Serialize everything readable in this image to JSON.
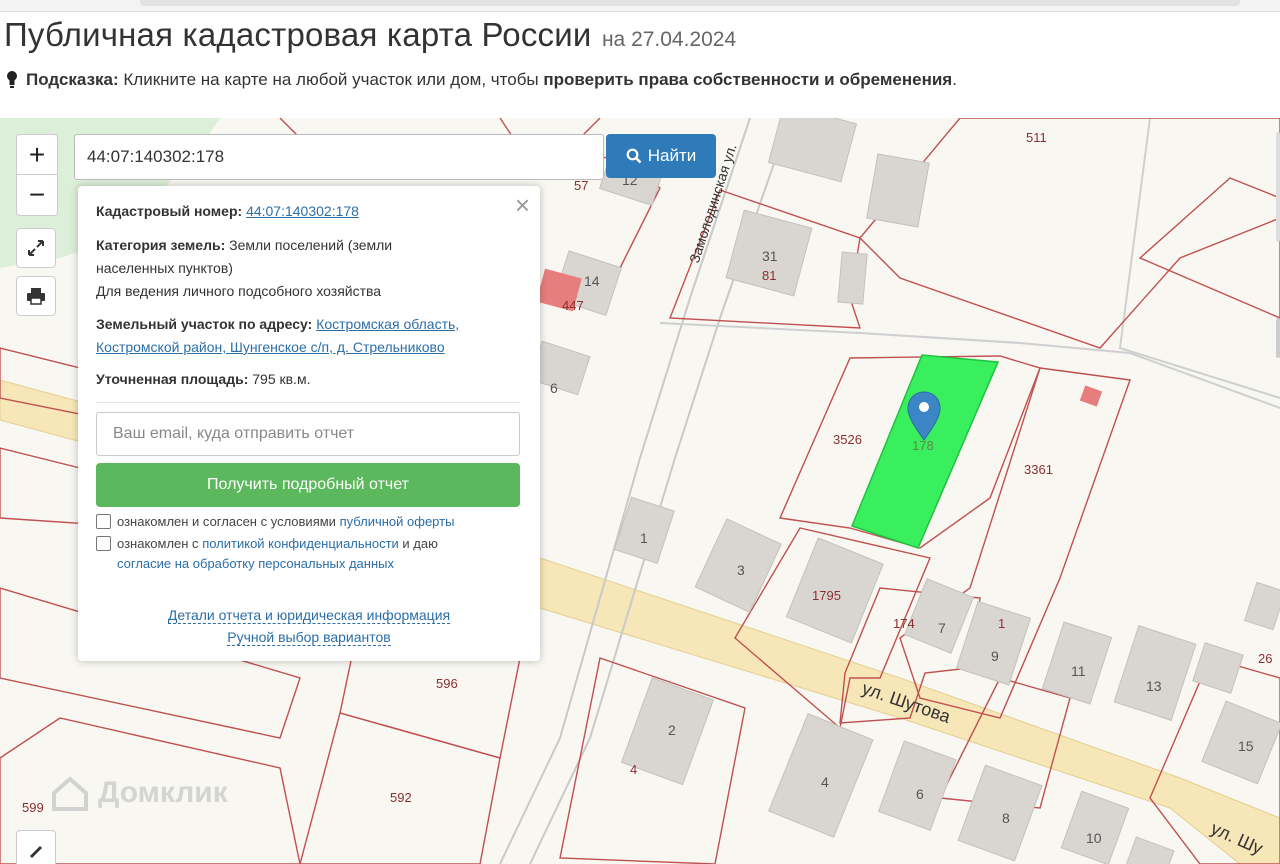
{
  "header": {
    "title": "Публичная кадастровая карта России",
    "date": "на 27.04.2024"
  },
  "hint": {
    "prefix": "Подсказка:",
    "text": " Кликните на карте на любой участок или дом, чтобы ",
    "bold": "проверить права собственности и обременения",
    "suffix": "."
  },
  "map": {
    "zoom_in": "+",
    "zoom_out": "−",
    "search": {
      "value": "44:07:140302:178",
      "button": "Найти"
    },
    "popup": {
      "close": "×",
      "cadastral_label": "Кадастровый номер:",
      "cadastral_value": "44:07:140302:178",
      "category_label": "Категория земель:",
      "category_value": "Земли поселений (земли",
      "category_value_2": "населенных пунктов)",
      "usage": "Для ведения личного подсобного хозяйства",
      "address_label": "Земельный участок по адресу:",
      "address_link_1": "Костромская область,",
      "address_link_2": "Костромской район, Шунгенское с/п, д. Стрельниково",
      "area_label": "Уточненная площадь:",
      "area_value": "795 кв.м.",
      "email_placeholder": "Ваш email, куда отправить отчет",
      "report_button": "Получить подробный отчет",
      "consent_1_text": "ознакомлен и согласен с условиями",
      "consent_1_link": "публичной оферты",
      "consent_2_text": "ознакомлен с",
      "consent_2_link": "политикой конфиденциальности",
      "consent_2_and": "и даю",
      "consent_2_link_2": "согласие на обработку персональных данных",
      "details_link": "Детали отчета и юридическая информация",
      "manual_link": "Ручной выбор вариантов"
    },
    "labels": {
      "p511": "511",
      "p12": "12",
      "p57": "57",
      "p31": "31",
      "p81": "81",
      "p14": "14",
      "p447": "447",
      "p6": "6",
      "p3526": "3526",
      "p178": "178",
      "p3361": "3361",
      "p1a": "1",
      "p3": "3",
      "p1795": "1795",
      "p174": "174",
      "p7": "7",
      "p1b": "1",
      "p9": "9",
      "p11": "11",
      "p13": "13",
      "p26": "26",
      "p596": "596",
      "p2": "2",
      "p4a": "4",
      "p15": "15",
      "p4b": "4",
      "p6b": "6",
      "p599": "599",
      "p592": "592",
      "p8": "8",
      "p10": "10"
    },
    "streets": {
      "zamolodinskaya": "Замолодинская ул.",
      "shutova": "ул. Шутова",
      "shutova_2": "ул. Шу"
    },
    "watermark": "Домклик"
  },
  "colors": {
    "selected_parcel": "#39ef5e",
    "parcel_border": "#c05050",
    "building": "#d9d6d2",
    "road": "#f6e2b0",
    "search_button": "#2f7ab8",
    "report_button": "#5cb85c",
    "link": "#2b6ea6"
  }
}
